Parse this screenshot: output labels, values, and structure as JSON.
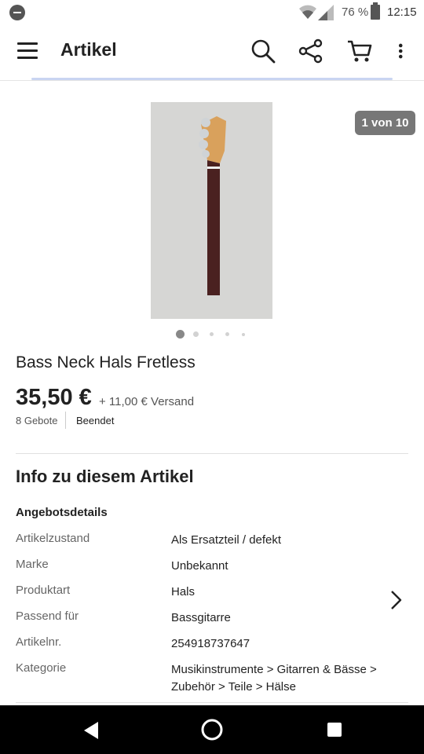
{
  "status_bar": {
    "battery_text": "76 %",
    "time": "12:15"
  },
  "app_bar": {
    "title": "Artikel"
  },
  "gallery": {
    "counter": "1 von 10",
    "total_dots": 5,
    "active_dot": 0
  },
  "product": {
    "title": "Bass Neck Hals Fretless",
    "price": "35,50 €",
    "shipping": "+ 11,00 € Versand",
    "bids": "8 Gebote",
    "status": "Beendet"
  },
  "info": {
    "heading": "Info zu diesem Artikel",
    "subheading": "Angebotsdetails",
    "rows": [
      {
        "label": "Artikelzustand",
        "value": "Als Ersatzteil / defekt"
      },
      {
        "label": "Marke",
        "value": "Unbekannt"
      },
      {
        "label": "Produktart",
        "value": "Hals"
      },
      {
        "label": "Passend für",
        "value": "Bassgitarre"
      },
      {
        "label": "Artikelnr.",
        "value": "254918737647"
      },
      {
        "label": "Kategorie",
        "value": "Musikinstrumente > Gitarren & Bässe > Zubehör > Teile > Hälse"
      }
    ]
  },
  "colors": {
    "accent_bar": "#c9d5f2",
    "badge_bg": "#777777",
    "nav_bg": "#000000"
  }
}
